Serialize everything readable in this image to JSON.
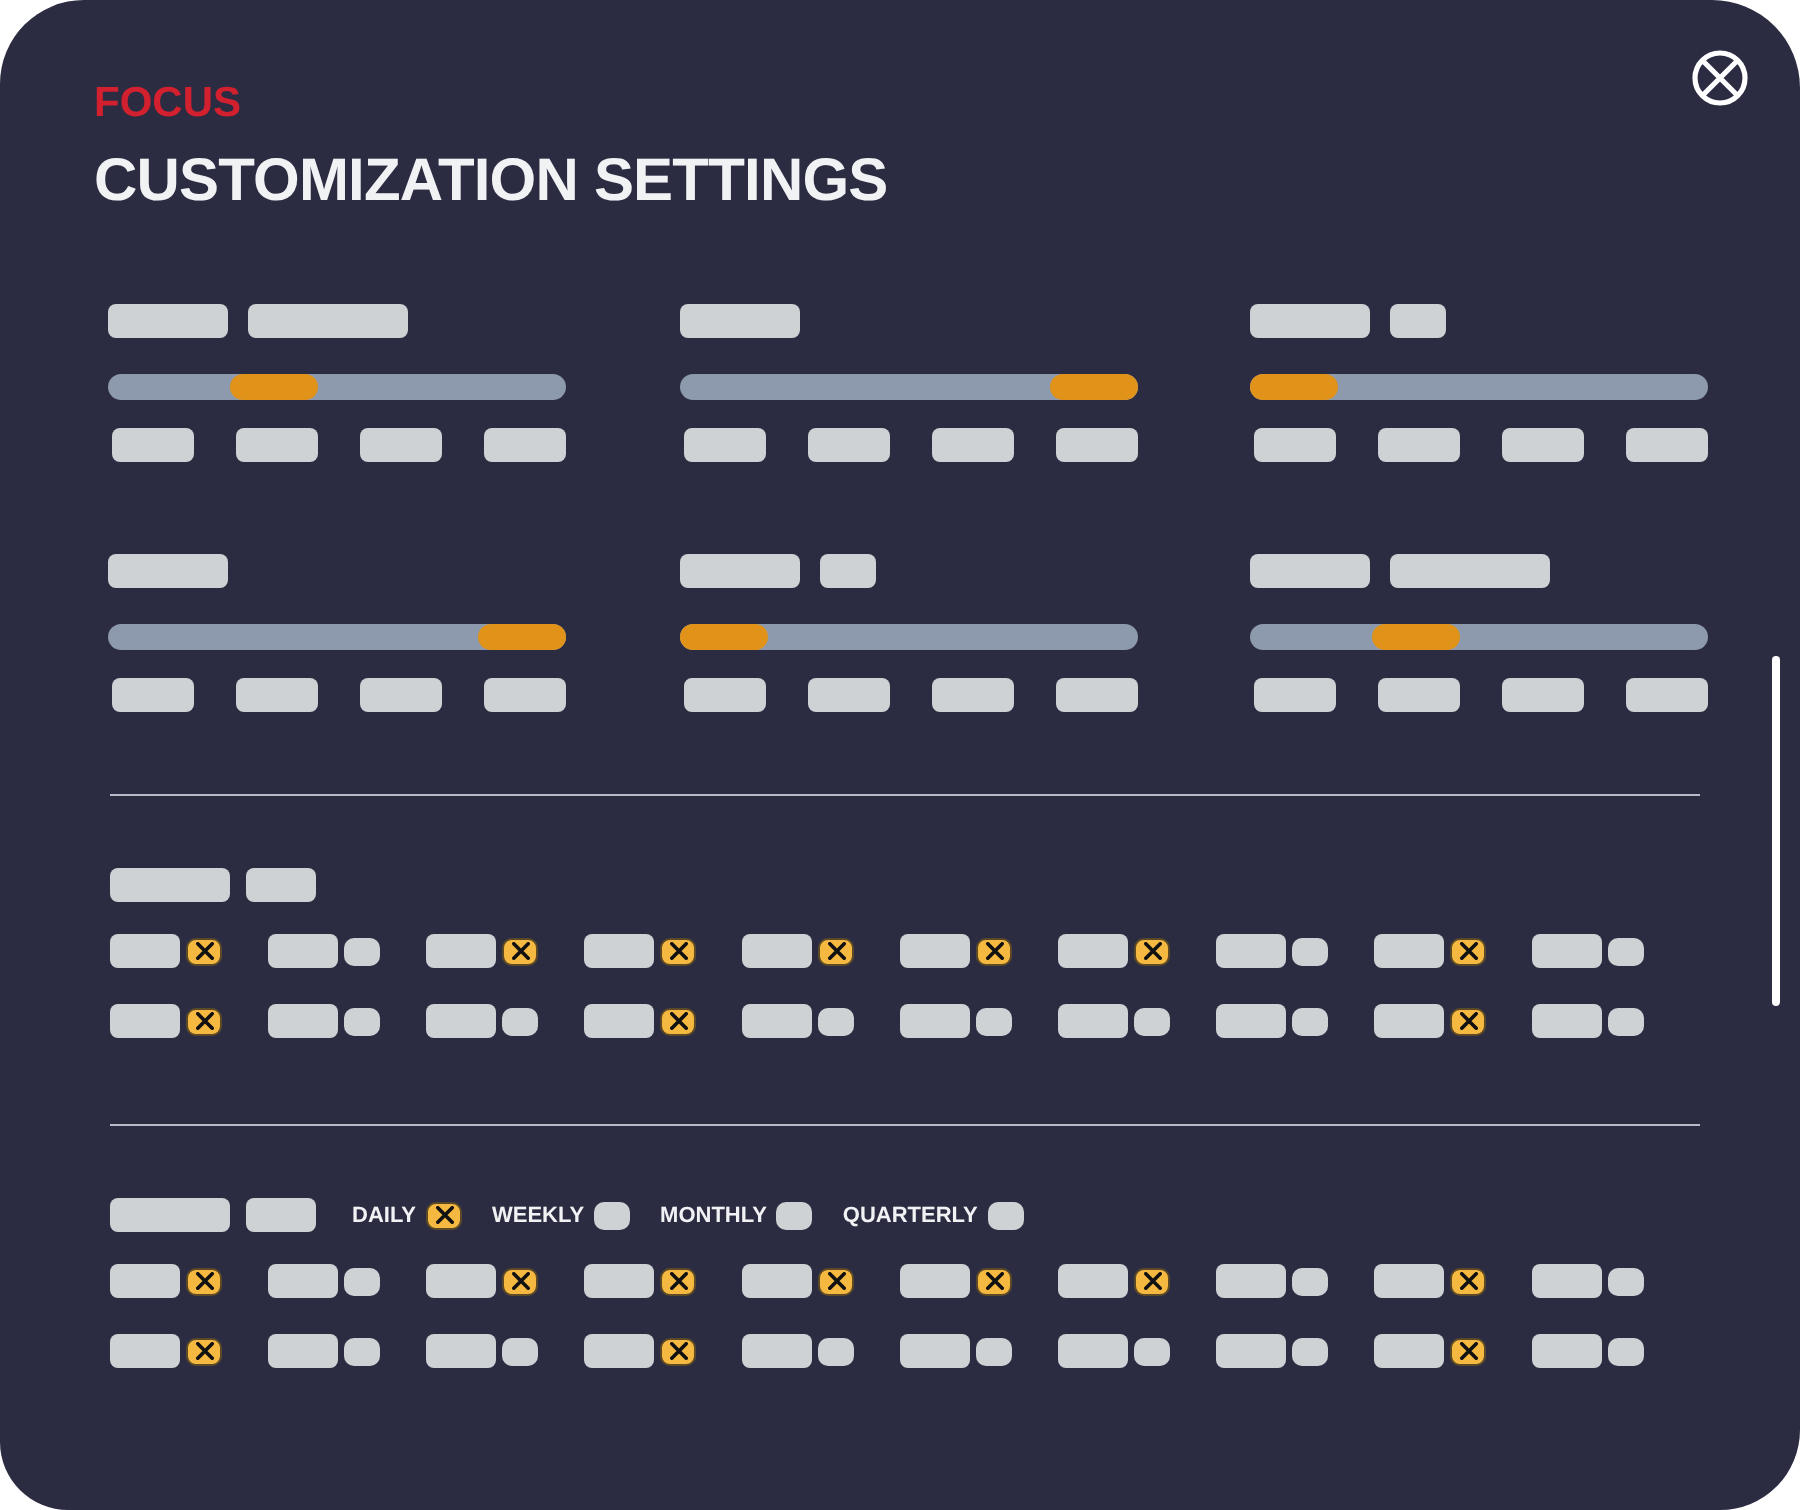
{
  "header": {
    "eyebrow": "FOCUS",
    "title": "CUSTOMIZATION SETTINGS"
  },
  "sliders": [
    {
      "label_blocks": [
        {
          "kind": "long"
        },
        {
          "kind": "extralong"
        }
      ],
      "level": 0.33,
      "stops": [
        {
          "kind": "medium"
        },
        {
          "kind": "medium"
        },
        {
          "kind": "medium"
        },
        {
          "kind": "medium"
        }
      ]
    },
    {
      "label_blocks": [
        {
          "kind": "long"
        }
      ],
      "level": 1,
      "stops": [
        {
          "kind": "medium"
        },
        {
          "kind": "medium"
        },
        {
          "kind": "medium"
        },
        {
          "kind": "medium"
        }
      ]
    },
    {
      "label_blocks": [
        {
          "kind": "long"
        },
        {
          "kind": "short"
        }
      ],
      "level": 0,
      "stops": [
        {
          "kind": "medium"
        },
        {
          "kind": "medium"
        },
        {
          "kind": "medium"
        },
        {
          "kind": "medium"
        }
      ]
    },
    {
      "label_blocks": [
        {
          "kind": "long"
        }
      ],
      "level": 1,
      "stops": [
        {
          "kind": "medium"
        },
        {
          "kind": "medium"
        },
        {
          "kind": "medium"
        },
        {
          "kind": "medium"
        }
      ]
    },
    {
      "label_blocks": [
        {
          "kind": "long"
        },
        {
          "kind": "short"
        }
      ],
      "level": 0,
      "stops": [
        {
          "kind": "medium"
        },
        {
          "kind": "medium"
        },
        {
          "kind": "medium"
        },
        {
          "kind": "medium"
        }
      ]
    },
    {
      "label_blocks": [
        {
          "kind": "long"
        },
        {
          "kind": "extralong"
        }
      ],
      "level": 0.33,
      "stops": [
        {
          "kind": "medium"
        },
        {
          "kind": "medium"
        },
        {
          "kind": "medium"
        },
        {
          "kind": "medium"
        }
      ]
    }
  ],
  "option_groups": [
    {
      "heading_blocks": [
        {
          "kind": "long"
        },
        {
          "kind": "medium"
        }
      ],
      "rows": [
        {
          "items": [
            {
              "checked": true
            },
            {
              "checked": false
            },
            {
              "checked": true
            },
            {
              "checked": true
            },
            {
              "checked": true
            },
            {
              "checked": true
            },
            {
              "checked": true
            },
            {
              "checked": false
            },
            {
              "checked": true
            },
            {
              "checked": false
            }
          ]
        },
        {
          "items": [
            {
              "checked": true
            },
            {
              "checked": false
            },
            {
              "checked": false
            },
            {
              "checked": true
            },
            {
              "checked": false
            },
            {
              "checked": false
            },
            {
              "checked": false
            },
            {
              "checked": false
            },
            {
              "checked": true
            },
            {
              "checked": false
            }
          ]
        }
      ]
    },
    {
      "heading_blocks": [
        {
          "kind": "long"
        },
        {
          "kind": "medium"
        }
      ],
      "frequencies": [
        {
          "label": "DAILY",
          "checked": true
        },
        {
          "label": "WEEKLY",
          "checked": false
        },
        {
          "label": "MONTHLY",
          "checked": false
        },
        {
          "label": "QUARTERLY",
          "checked": false
        }
      ],
      "rows": [
        {
          "items": [
            {
              "checked": true
            },
            {
              "checked": false
            },
            {
              "checked": true
            },
            {
              "checked": true
            },
            {
              "checked": true
            },
            {
              "checked": true
            },
            {
              "checked": true
            },
            {
              "checked": false
            },
            {
              "checked": true
            },
            {
              "checked": false
            }
          ]
        },
        {
          "items": [
            {
              "checked": true
            },
            {
              "checked": false
            },
            {
              "checked": false
            },
            {
              "checked": true
            },
            {
              "checked": false
            },
            {
              "checked": false
            },
            {
              "checked": false
            },
            {
              "checked": false
            },
            {
              "checked": true
            },
            {
              "checked": false
            }
          ]
        }
      ]
    }
  ]
}
